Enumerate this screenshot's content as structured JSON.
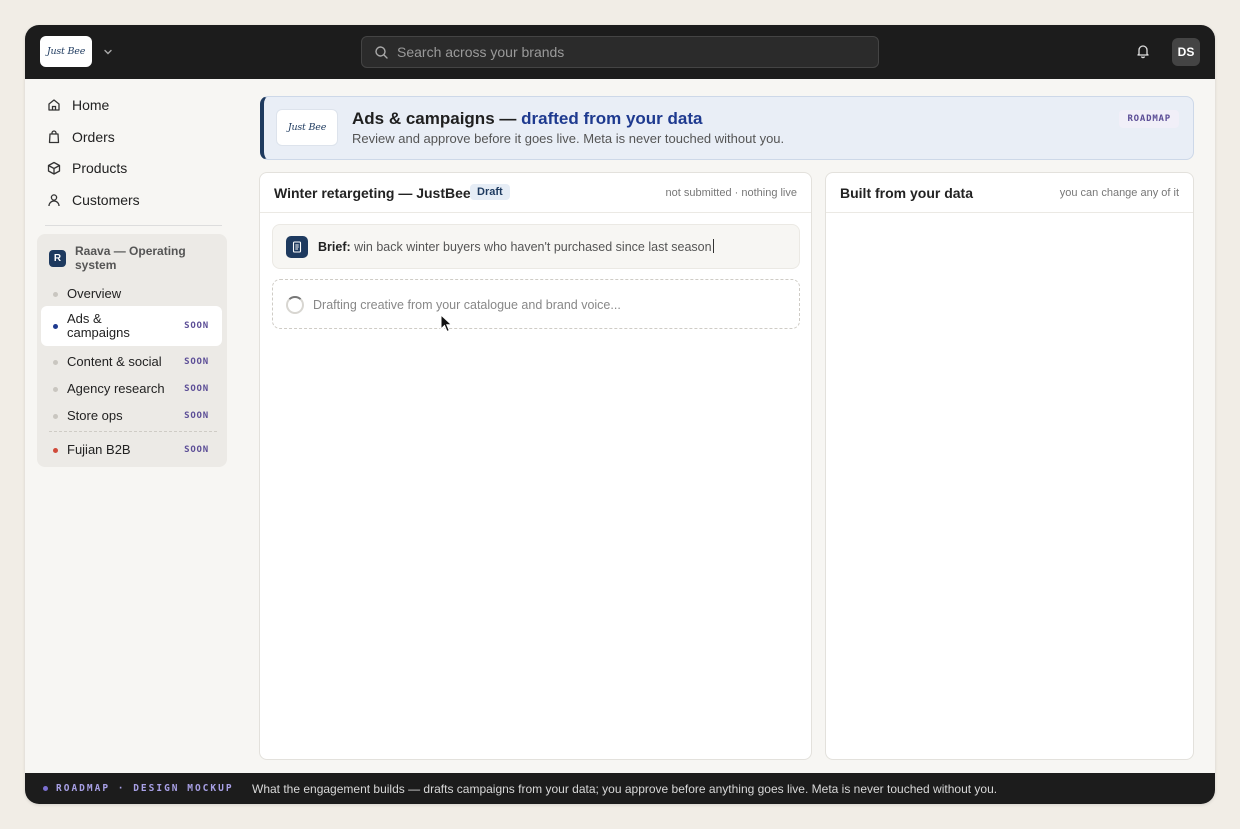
{
  "topbar": {
    "brand_logo_text": "Just Bee",
    "search_placeholder": "Search across your brands",
    "avatar_initials": "DS"
  },
  "sidebar": {
    "nav": [
      {
        "label": "Home",
        "icon": "home-icon"
      },
      {
        "label": "Orders",
        "icon": "bag-icon"
      },
      {
        "label": "Products",
        "icon": "box-icon"
      },
      {
        "label": "Customers",
        "icon": "user-icon"
      }
    ],
    "raava": {
      "badge": "R",
      "title": "Raava — Operating system",
      "items": [
        {
          "label": "Overview",
          "soon": ""
        },
        {
          "label": "Ads & campaigns",
          "soon": "SOON",
          "active": true
        },
        {
          "label": "Content & social",
          "soon": "SOON"
        },
        {
          "label": "Agency research",
          "soon": "SOON"
        },
        {
          "label": "Store ops",
          "soon": "SOON"
        },
        {
          "label": "Fujian B2B",
          "soon": "SOON"
        }
      ]
    }
  },
  "hero": {
    "title_main": "Ads & campaigns — ",
    "title_accent": "drafted from your data",
    "subtitle": "Review and approve before it goes live. Meta is never touched without you.",
    "tag": "ROADMAP",
    "logo_text": "Just Bee"
  },
  "campaign_card": {
    "title": "Winter retargeting — JustBee",
    "badge": "Draft",
    "meta": "not submitted · nothing live",
    "brief_label": "Brief:",
    "brief_text": " win back winter buyers who haven't purchased since last season",
    "drafting_text": "Drafting creative from your catalogue and brand voice..."
  },
  "data_card": {
    "title": "Built from your data",
    "meta": "you can change any of it"
  },
  "footer": {
    "tag": "ROADMAP · DESIGN MOCKUP",
    "text": "What the engagement builds — drafts campaigns from your data; you approve before anything goes live. Meta is never touched without you."
  },
  "colors": {
    "accent": "#1e3a5f",
    "soon": "#5b4d96",
    "active_dot": "#1e3a8f",
    "fujian_dot": "#d04a3a"
  }
}
